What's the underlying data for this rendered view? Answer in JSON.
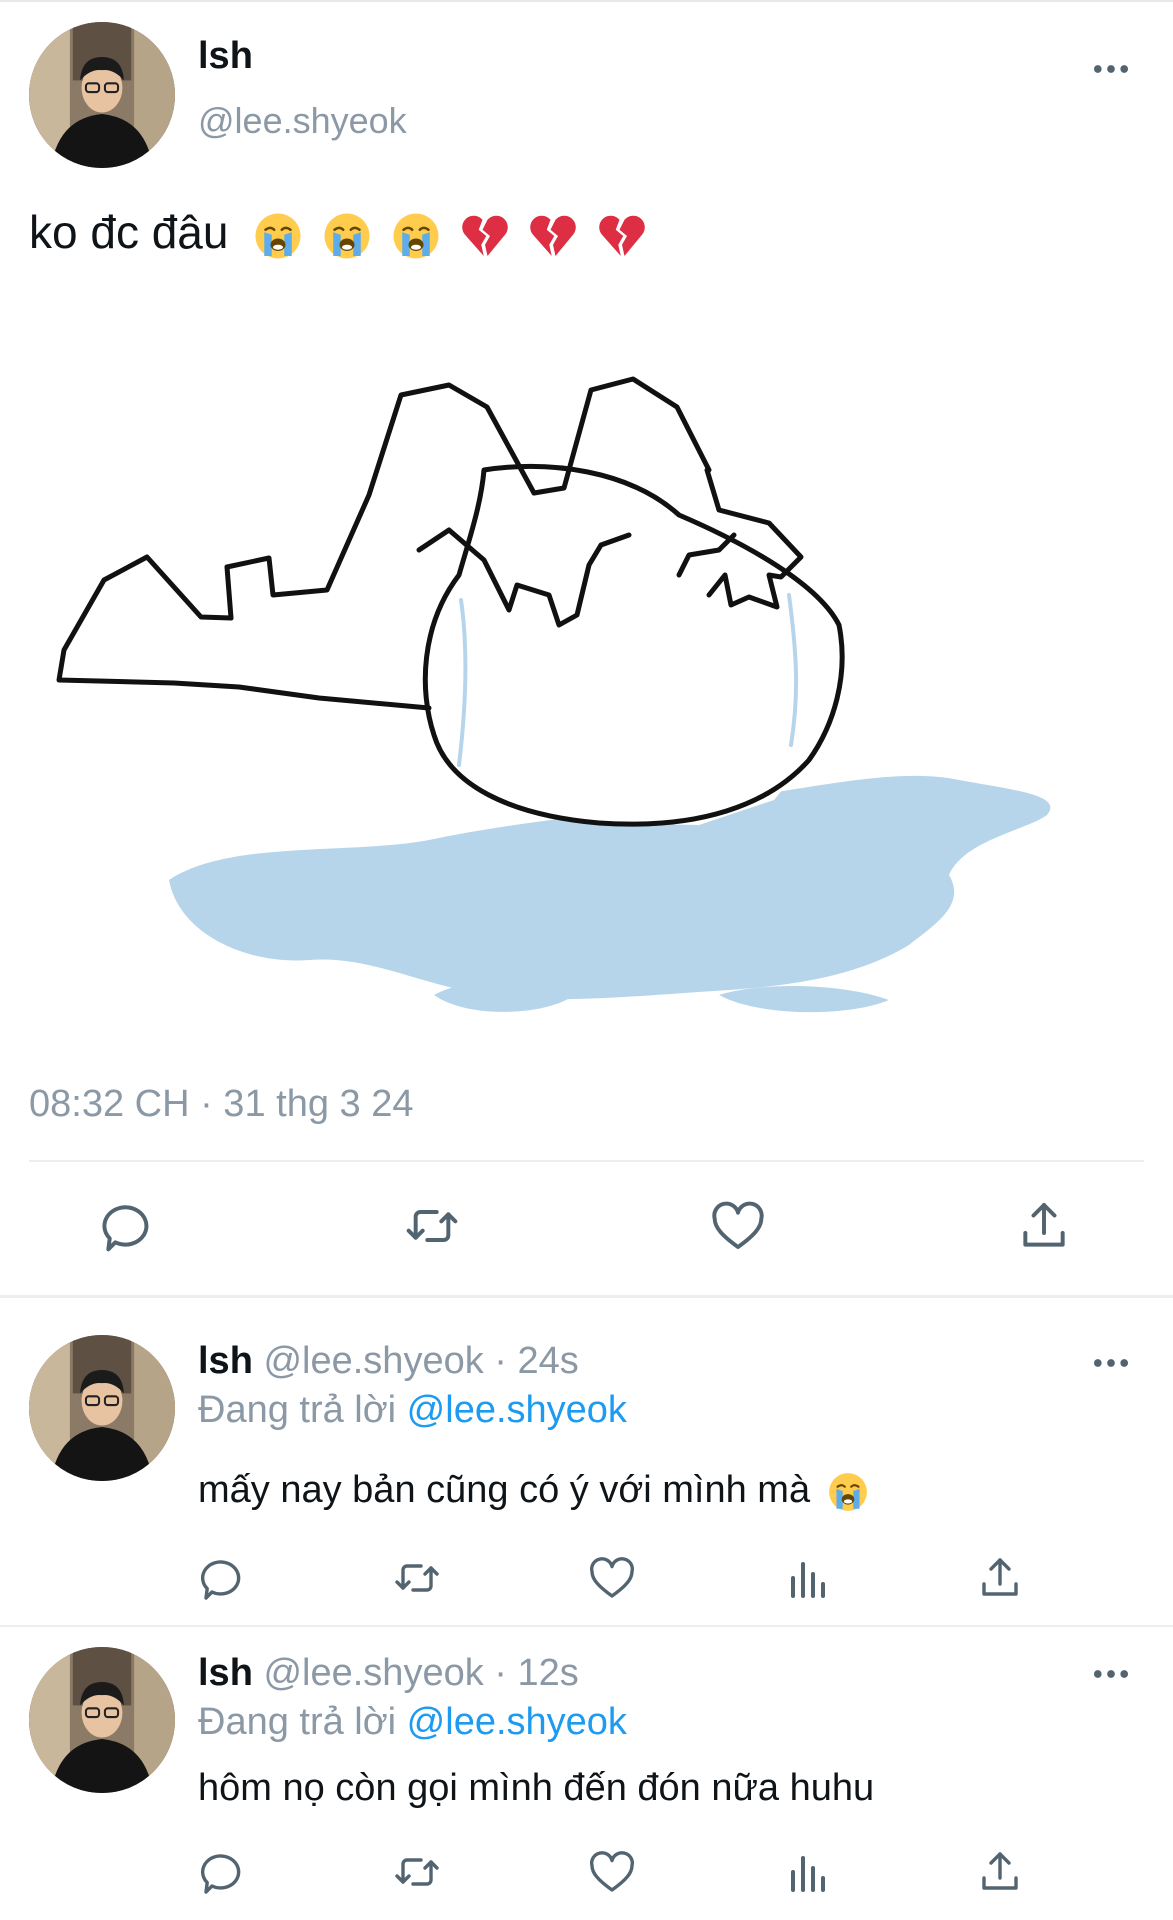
{
  "main_tweet": {
    "display_name": "lsh",
    "handle": "@lee.shyeok",
    "text": "ko đc đâu",
    "emojis": [
      "loudly-crying-face",
      "loudly-crying-face",
      "loudly-crying-face",
      "broken-heart",
      "broken-heart",
      "broken-heart"
    ],
    "timestamp": "08:32 CH · 31 thg 3 24",
    "actions": [
      "reply-icon",
      "retweet-icon",
      "like-icon",
      "share-icon"
    ]
  },
  "replies": [
    {
      "display_name": "lsh",
      "handle_time": "@lee.shyeok · 24s",
      "replying_prefix": "Đang trả lời",
      "replying_to": "@lee.shyeok",
      "text": "mấy nay bản cũng có ý với mình mà",
      "emoji": "loudly-crying-face"
    },
    {
      "display_name": "lsh",
      "handle_time": "@lee.shyeok · 12s",
      "replying_prefix": "Đang trả lời",
      "replying_to": "@lee.shyeok",
      "text": "hôm nọ còn gọi mình đến đón nữa huhu"
    }
  ],
  "colors": {
    "accent": "#1d9bf0",
    "muted": "#8b98a5",
    "puddle": "#b7d5ea"
  }
}
